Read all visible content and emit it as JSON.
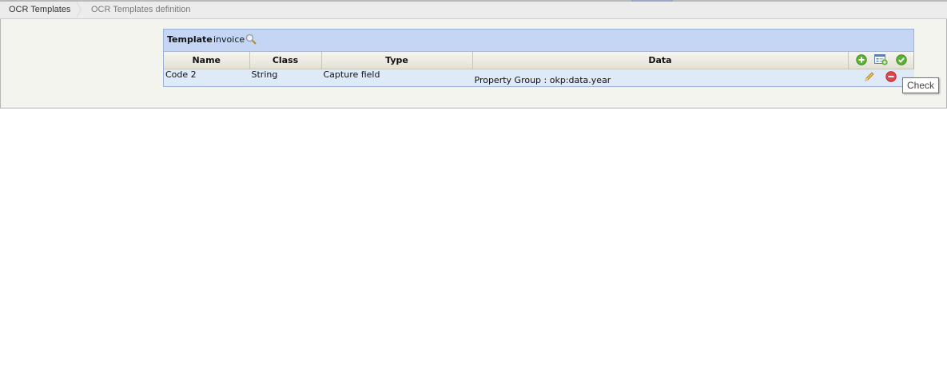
{
  "breadcrumb": {
    "items": [
      "OCR Templates",
      "OCR Templates definition"
    ]
  },
  "panel": {
    "title_label": "Template",
    "title_value": "invoice"
  },
  "table": {
    "columns": [
      "Name",
      "Class",
      "Type",
      "Data"
    ],
    "rows": [
      {
        "name": "Code 2",
        "class": "String",
        "type": "Capture field",
        "data": "Property Group : okp:data.year"
      }
    ]
  },
  "tooltip": {
    "text": "Check"
  },
  "icons": {
    "search": "magnifier-icon",
    "add": "add-icon",
    "add_form": "add-form-icon",
    "check": "check-icon",
    "edit": "pencil-icon",
    "remove": "remove-icon"
  },
  "colors": {
    "panel_header": "#c5d6f5",
    "row_background": "#dfeaf9",
    "add_green": "#5bb234",
    "remove_red": "#e0474c"
  }
}
